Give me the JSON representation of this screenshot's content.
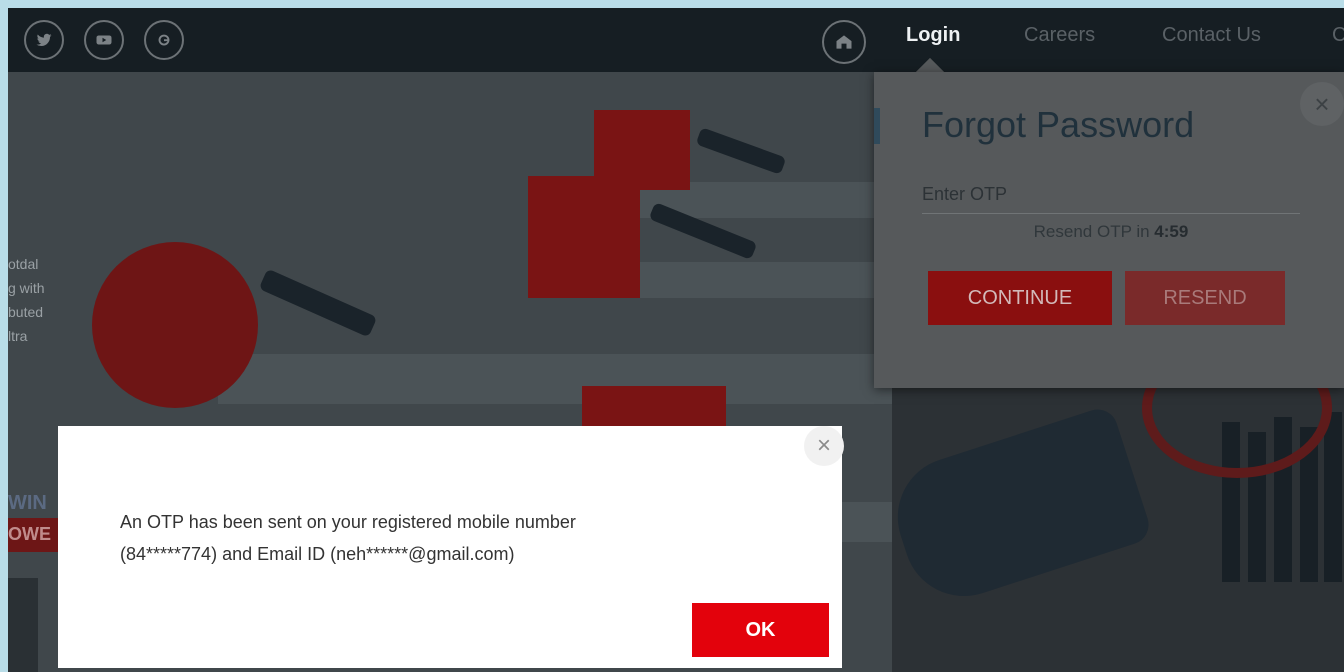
{
  "nav": {
    "social_icons": [
      "twitter-icon",
      "youtube-icon",
      "google-plus-icon"
    ],
    "home_icon": "home-icon",
    "links": [
      "Login",
      "Careers",
      "Contact Us",
      "C"
    ]
  },
  "background": {
    "side_text": "otdal\ng with\nbuted\nltra",
    "win_text": "WIN",
    "pow_text": "OWE"
  },
  "forgot_password": {
    "title": "Forgot Password",
    "otp_placeholder": "Enter OTP",
    "resend_prefix": "Resend OTP in ",
    "resend_timer": "4:59",
    "continue_label": "CONTINUE",
    "resend_label": "RESEND",
    "close_glyph": "×"
  },
  "otp_modal": {
    "message": "An OTP has been sent on your registered mobile number\n(84*****774) and Email ID (neh******@gmail.com)",
    "ok_label": "OK",
    "close_glyph": "×"
  },
  "colors": {
    "primary_red": "#e3020c",
    "nav_bg": "#161e23"
  }
}
